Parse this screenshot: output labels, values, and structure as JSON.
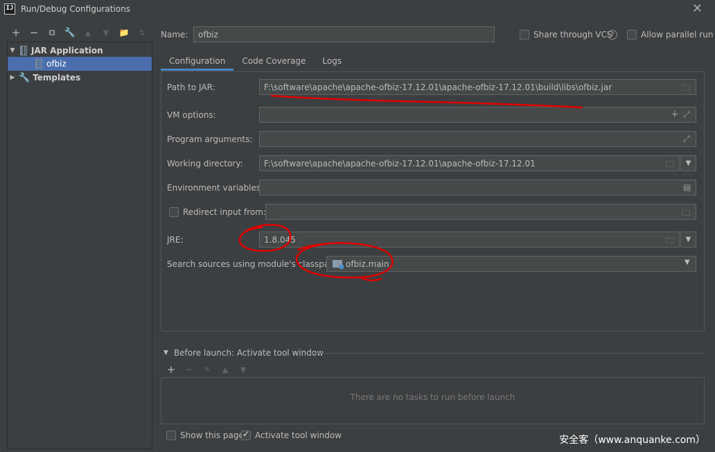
{
  "window": {
    "title": "Run/Debug Configurations",
    "app_icon_text": "IJ"
  },
  "left_toolbar": {
    "add": "+",
    "remove": "−",
    "copy": "⧉",
    "edit": "🔧",
    "up": "▲",
    "down": "▼",
    "folder": "📁",
    "sort": "⇅"
  },
  "tree": {
    "items": [
      {
        "label": "JAR Application",
        "expanded": true
      },
      {
        "label": "ofbiz",
        "selected": true
      },
      {
        "label": "Templates",
        "expanded": false
      }
    ]
  },
  "header": {
    "name_label": "Name:",
    "name_value": "ofbiz",
    "share_label": "Share through VCS",
    "parallel_label": "Allow parallel run",
    "share_checked": false,
    "parallel_checked": false
  },
  "tabs": [
    {
      "label": "Configuration",
      "active": true
    },
    {
      "label": "Code Coverage"
    },
    {
      "label": "Logs"
    }
  ],
  "form": {
    "path_to_jar": {
      "label": "Path to JAR:",
      "value": "F:\\software\\apache\\apache-ofbiz-17.12.01\\apache-ofbiz-17.12.01\\build\\libs\\ofbiz.jar"
    },
    "vm_options": {
      "label": "VM options:",
      "value": ""
    },
    "program_arguments": {
      "label": "Program arguments:",
      "value": ""
    },
    "working_directory": {
      "label": "Working directory:",
      "value": "F:\\software\\apache\\apache-ofbiz-17.12.01\\apache-ofbiz-17.12.01"
    },
    "environment_variables": {
      "label": "Environment variables:",
      "value": ""
    },
    "redirect_input": {
      "label": "Redirect input from:",
      "value": "",
      "checked": false
    },
    "jre": {
      "label": "JRE:",
      "value": "1.8.045"
    },
    "module_classpath": {
      "label": "Search sources using module's classpath:",
      "value": "ofbiz.main"
    }
  },
  "before_launch": {
    "title": "Before launch: Activate tool window",
    "empty_message": "There are no tasks to run before launch"
  },
  "footer": {
    "show_page_label": "Show this page",
    "show_page_checked": false,
    "activate_label": "Activate tool window",
    "activate_checked": true
  },
  "watermark": "安全客（www.anquanke.com）",
  "colors": {
    "background": "#3c3f41",
    "selection": "#4b6eaf",
    "tab_underline": "#4a88c7",
    "annotation": "#e00000"
  }
}
